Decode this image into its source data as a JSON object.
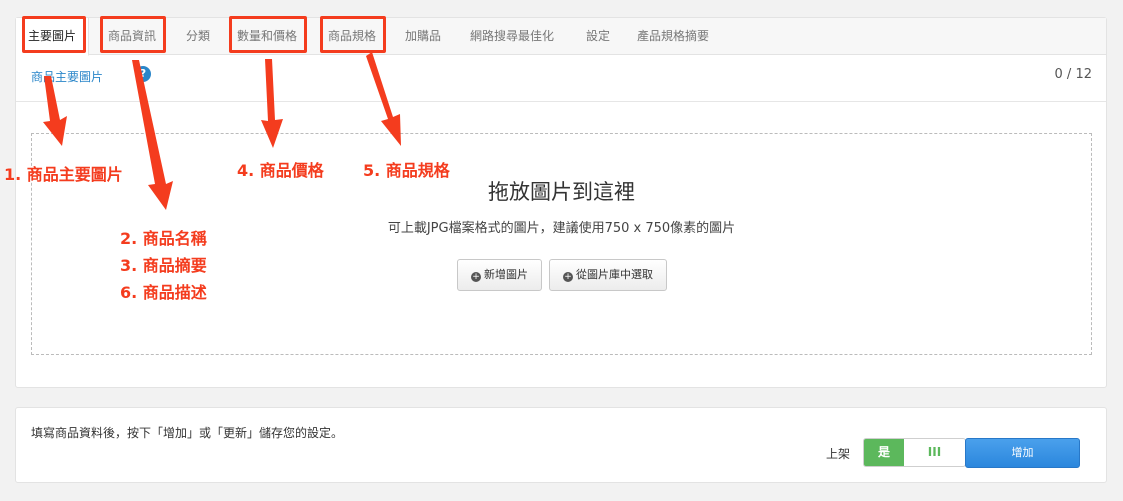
{
  "tabs": [
    {
      "label": "主要圖片",
      "active": true
    },
    {
      "label": "商品資訊",
      "active": false
    },
    {
      "label": "分類",
      "active": false
    },
    {
      "label": "數量和價格",
      "active": false
    },
    {
      "label": "商品規格",
      "active": false
    },
    {
      "label": "加購品",
      "active": false
    },
    {
      "label": "網路搜尋最佳化",
      "active": false
    },
    {
      "label": "設定",
      "active": false
    },
    {
      "label": "產品規格摘要",
      "active": false
    }
  ],
  "images_section": {
    "title": "商品主要圖片",
    "help_glyph": "?",
    "counter": "0 / 12"
  },
  "dropzone": {
    "title": "拖放圖片到這裡",
    "hint": "可上載JPG檔案格式的圖片，建議使用750 x 750像素的圖片",
    "add_button": "新增圖片",
    "library_button": "從圖片庫中選取",
    "plus_glyph": "+"
  },
  "footer": {
    "notice": "填寫商品資料後，按下「增加」或「更新」儲存您的設定。",
    "shelf_label": "上架",
    "toggle_on": "是",
    "toggle_off": "III",
    "submit_button": "增加"
  },
  "annotations": [
    "1. 商品主要圖片",
    "2. 商品名稱",
    "3. 商品摘要",
    "6. 商品描述",
    "4. 商品價格",
    "5. 商品規格"
  ],
  "colors": {
    "accent": "#f43c1e",
    "link": "#2a86c9",
    "toggle_green": "#5cb85c",
    "primary_button": "#2b87dd"
  }
}
